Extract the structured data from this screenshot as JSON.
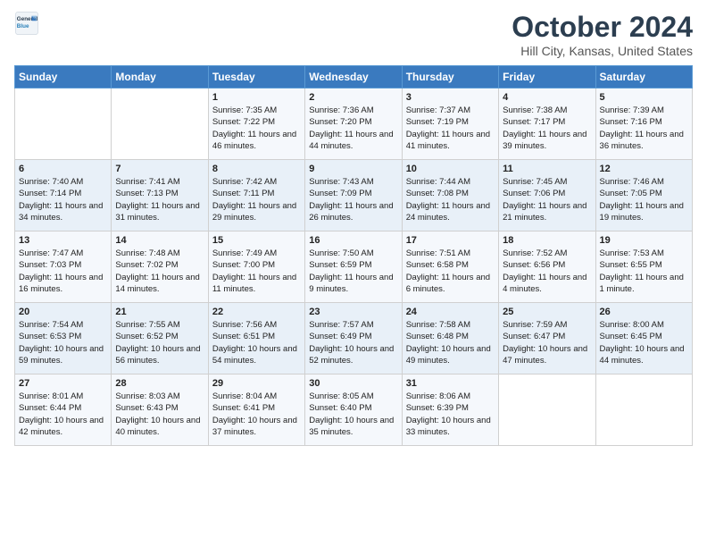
{
  "header": {
    "logo_general": "General",
    "logo_blue": "Blue",
    "title": "October 2024",
    "subtitle": "Hill City, Kansas, United States"
  },
  "columns": [
    "Sunday",
    "Monday",
    "Tuesday",
    "Wednesday",
    "Thursday",
    "Friday",
    "Saturday"
  ],
  "rows": [
    [
      {
        "day": "",
        "sunrise": "",
        "sunset": "",
        "daylight": ""
      },
      {
        "day": "",
        "sunrise": "",
        "sunset": "",
        "daylight": ""
      },
      {
        "day": "1",
        "sunrise": "Sunrise: 7:35 AM",
        "sunset": "Sunset: 7:22 PM",
        "daylight": "Daylight: 11 hours and 46 minutes."
      },
      {
        "day": "2",
        "sunrise": "Sunrise: 7:36 AM",
        "sunset": "Sunset: 7:20 PM",
        "daylight": "Daylight: 11 hours and 44 minutes."
      },
      {
        "day": "3",
        "sunrise": "Sunrise: 7:37 AM",
        "sunset": "Sunset: 7:19 PM",
        "daylight": "Daylight: 11 hours and 41 minutes."
      },
      {
        "day": "4",
        "sunrise": "Sunrise: 7:38 AM",
        "sunset": "Sunset: 7:17 PM",
        "daylight": "Daylight: 11 hours and 39 minutes."
      },
      {
        "day": "5",
        "sunrise": "Sunrise: 7:39 AM",
        "sunset": "Sunset: 7:16 PM",
        "daylight": "Daylight: 11 hours and 36 minutes."
      }
    ],
    [
      {
        "day": "6",
        "sunrise": "Sunrise: 7:40 AM",
        "sunset": "Sunset: 7:14 PM",
        "daylight": "Daylight: 11 hours and 34 minutes."
      },
      {
        "day": "7",
        "sunrise": "Sunrise: 7:41 AM",
        "sunset": "Sunset: 7:13 PM",
        "daylight": "Daylight: 11 hours and 31 minutes."
      },
      {
        "day": "8",
        "sunrise": "Sunrise: 7:42 AM",
        "sunset": "Sunset: 7:11 PM",
        "daylight": "Daylight: 11 hours and 29 minutes."
      },
      {
        "day": "9",
        "sunrise": "Sunrise: 7:43 AM",
        "sunset": "Sunset: 7:09 PM",
        "daylight": "Daylight: 11 hours and 26 minutes."
      },
      {
        "day": "10",
        "sunrise": "Sunrise: 7:44 AM",
        "sunset": "Sunset: 7:08 PM",
        "daylight": "Daylight: 11 hours and 24 minutes."
      },
      {
        "day": "11",
        "sunrise": "Sunrise: 7:45 AM",
        "sunset": "Sunset: 7:06 PM",
        "daylight": "Daylight: 11 hours and 21 minutes."
      },
      {
        "day": "12",
        "sunrise": "Sunrise: 7:46 AM",
        "sunset": "Sunset: 7:05 PM",
        "daylight": "Daylight: 11 hours and 19 minutes."
      }
    ],
    [
      {
        "day": "13",
        "sunrise": "Sunrise: 7:47 AM",
        "sunset": "Sunset: 7:03 PM",
        "daylight": "Daylight: 11 hours and 16 minutes."
      },
      {
        "day": "14",
        "sunrise": "Sunrise: 7:48 AM",
        "sunset": "Sunset: 7:02 PM",
        "daylight": "Daylight: 11 hours and 14 minutes."
      },
      {
        "day": "15",
        "sunrise": "Sunrise: 7:49 AM",
        "sunset": "Sunset: 7:00 PM",
        "daylight": "Daylight: 11 hours and 11 minutes."
      },
      {
        "day": "16",
        "sunrise": "Sunrise: 7:50 AM",
        "sunset": "Sunset: 6:59 PM",
        "daylight": "Daylight: 11 hours and 9 minutes."
      },
      {
        "day": "17",
        "sunrise": "Sunrise: 7:51 AM",
        "sunset": "Sunset: 6:58 PM",
        "daylight": "Daylight: 11 hours and 6 minutes."
      },
      {
        "day": "18",
        "sunrise": "Sunrise: 7:52 AM",
        "sunset": "Sunset: 6:56 PM",
        "daylight": "Daylight: 11 hours and 4 minutes."
      },
      {
        "day": "19",
        "sunrise": "Sunrise: 7:53 AM",
        "sunset": "Sunset: 6:55 PM",
        "daylight": "Daylight: 11 hours and 1 minute."
      }
    ],
    [
      {
        "day": "20",
        "sunrise": "Sunrise: 7:54 AM",
        "sunset": "Sunset: 6:53 PM",
        "daylight": "Daylight: 10 hours and 59 minutes."
      },
      {
        "day": "21",
        "sunrise": "Sunrise: 7:55 AM",
        "sunset": "Sunset: 6:52 PM",
        "daylight": "Daylight: 10 hours and 56 minutes."
      },
      {
        "day": "22",
        "sunrise": "Sunrise: 7:56 AM",
        "sunset": "Sunset: 6:51 PM",
        "daylight": "Daylight: 10 hours and 54 minutes."
      },
      {
        "day": "23",
        "sunrise": "Sunrise: 7:57 AM",
        "sunset": "Sunset: 6:49 PM",
        "daylight": "Daylight: 10 hours and 52 minutes."
      },
      {
        "day": "24",
        "sunrise": "Sunrise: 7:58 AM",
        "sunset": "Sunset: 6:48 PM",
        "daylight": "Daylight: 10 hours and 49 minutes."
      },
      {
        "day": "25",
        "sunrise": "Sunrise: 7:59 AM",
        "sunset": "Sunset: 6:47 PM",
        "daylight": "Daylight: 10 hours and 47 minutes."
      },
      {
        "day": "26",
        "sunrise": "Sunrise: 8:00 AM",
        "sunset": "Sunset: 6:45 PM",
        "daylight": "Daylight: 10 hours and 44 minutes."
      }
    ],
    [
      {
        "day": "27",
        "sunrise": "Sunrise: 8:01 AM",
        "sunset": "Sunset: 6:44 PM",
        "daylight": "Daylight: 10 hours and 42 minutes."
      },
      {
        "day": "28",
        "sunrise": "Sunrise: 8:03 AM",
        "sunset": "Sunset: 6:43 PM",
        "daylight": "Daylight: 10 hours and 40 minutes."
      },
      {
        "day": "29",
        "sunrise": "Sunrise: 8:04 AM",
        "sunset": "Sunset: 6:41 PM",
        "daylight": "Daylight: 10 hours and 37 minutes."
      },
      {
        "day": "30",
        "sunrise": "Sunrise: 8:05 AM",
        "sunset": "Sunset: 6:40 PM",
        "daylight": "Daylight: 10 hours and 35 minutes."
      },
      {
        "day": "31",
        "sunrise": "Sunrise: 8:06 AM",
        "sunset": "Sunset: 6:39 PM",
        "daylight": "Daylight: 10 hours and 33 minutes."
      },
      {
        "day": "",
        "sunrise": "",
        "sunset": "",
        "daylight": ""
      },
      {
        "day": "",
        "sunrise": "",
        "sunset": "",
        "daylight": ""
      }
    ]
  ]
}
